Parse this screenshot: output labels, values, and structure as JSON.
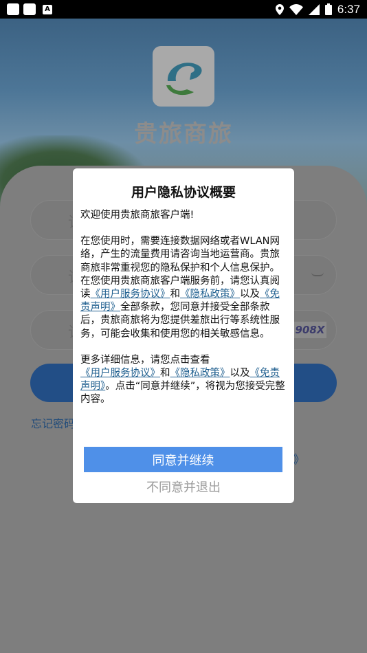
{
  "status_bar": {
    "time": "6:37"
  },
  "app": {
    "name": "贵旅商旅",
    "forgot_password": "忘记密码",
    "agree_fragment": "》",
    "captcha_text": "908X"
  },
  "dialog": {
    "title": "用户隐私协议概要",
    "welcome": "欢迎使用贵旅商旅客户端!",
    "p1_a": "在您使用时，需要连接数据网络或者WLAN网络，产生的流量费用请咨询当地运营商。贵旅商旅非常重视您的隐私保护和个人信息保护。在您使用贵旅商旅客户端服务前，请您认真阅读",
    "link_service": "《用户服务协议》",
    "and": "和",
    "link_privacy": "《隐私政策》",
    "and_also": "以及",
    "link_disclaimer": "《免责声明》",
    "p1_b": "全部条款，您同意并接受全部条款后，贵旅商旅将为您提供差旅出行等系统性服务，可能会收集和使用您的相关敏感信息。",
    "p2_a": "更多详细信息，请您点击查看",
    "p2_b": "。点击“同意并继续”，将视为您接受完整内容。",
    "accept_button": "同意并继续",
    "reject_button": "不同意并退出"
  }
}
